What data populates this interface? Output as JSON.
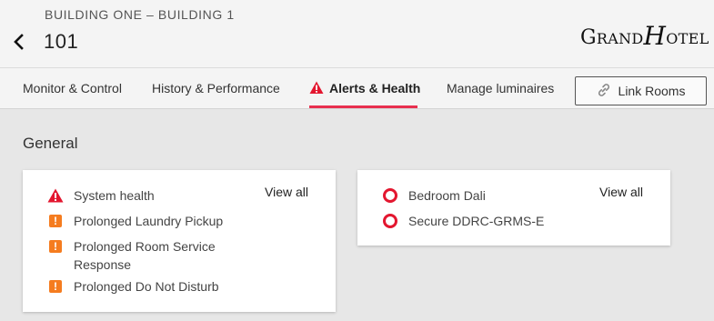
{
  "header": {
    "breadcrumb": "BUILDING ONE – BUILDING 1",
    "room": "101",
    "logo": {
      "big1": "G",
      "small1": "RAND",
      "script": "H",
      "small2": "OTEL"
    }
  },
  "tabs": [
    {
      "label": "Monitor & Control"
    },
    {
      "label": "History & Performance"
    },
    {
      "label": "Alerts & Health",
      "active": true
    },
    {
      "label": "Manage luminaires"
    }
  ],
  "link_rooms_label": "Link Rooms",
  "section_title": "General",
  "card_alerts": {
    "view_all": "View all",
    "items": [
      {
        "label": "System health",
        "icon": "warning-triangle-icon"
      },
      {
        "label": "Prolonged Laundry Pickup",
        "icon": "exclamation-square-icon"
      },
      {
        "label": "Prolonged Room Service Response",
        "icon": "exclamation-square-icon"
      },
      {
        "label": "Prolonged Do Not Disturb",
        "icon": "exclamation-square-icon"
      }
    ]
  },
  "card_devices": {
    "view_all": "View all",
    "items": [
      {
        "label": "Bedroom Dali",
        "icon": "ring-icon"
      },
      {
        "label": "Secure DDRC-GRMS-E",
        "icon": "ring-icon"
      }
    ]
  },
  "colors": {
    "accent": "#e8304f",
    "warning": "#f57c1f",
    "error": "#e3162f"
  }
}
